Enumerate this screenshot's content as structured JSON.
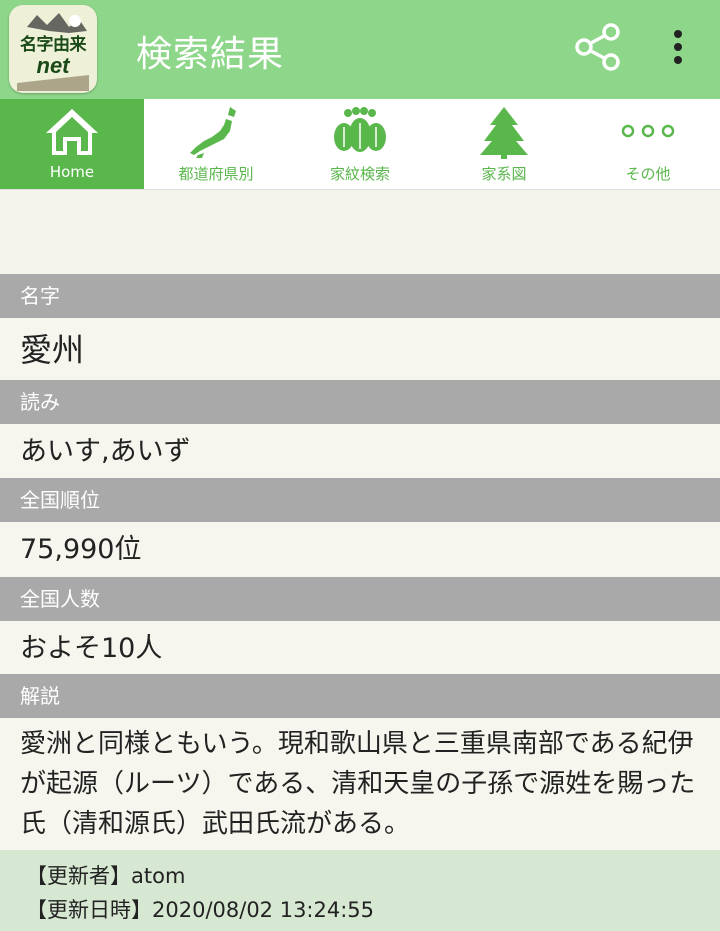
{
  "app": {
    "logo_text": "名字由来",
    "logo_sub": "net",
    "title": "検索結果",
    "share_icon": "share-icon",
    "more_icon": "more-vertical-icon",
    "colors": {
      "appbar": "#8ed68a",
      "accent": "#5ab74c",
      "header_gray": "#a9a9a9",
      "footer": "#d7e8d2"
    }
  },
  "tabs": [
    {
      "label": "Home",
      "icon": "home-icon",
      "active": true
    },
    {
      "label": "都道府県別",
      "icon": "japan-map-icon",
      "active": false
    },
    {
      "label": "家紋検索",
      "icon": "family-crest-icon",
      "active": false
    },
    {
      "label": "家系図",
      "icon": "tree-icon",
      "active": false
    },
    {
      "label": "その他",
      "icon": "more-dots-icon",
      "active": false
    }
  ],
  "surname": {
    "header": "名字",
    "value": "愛州"
  },
  "reading": {
    "header": "読み",
    "value": "あいす,あいず"
  },
  "rank": {
    "header": "全国順位",
    "value": "75,990位"
  },
  "population": {
    "header": "全国人数",
    "value": "およそ10人"
  },
  "description": {
    "header": "解説",
    "text": "愛洲と同様ともいう。現和歌山県と三重県南部である紀伊が起源（ルーツ）である、清和天皇の子孫で源姓を賜った氏（清和源氏）武田氏流がある。"
  },
  "footer": {
    "updater": "【更新者】atom",
    "updated_at": "【更新日時】2020/08/02 13:24:55"
  }
}
